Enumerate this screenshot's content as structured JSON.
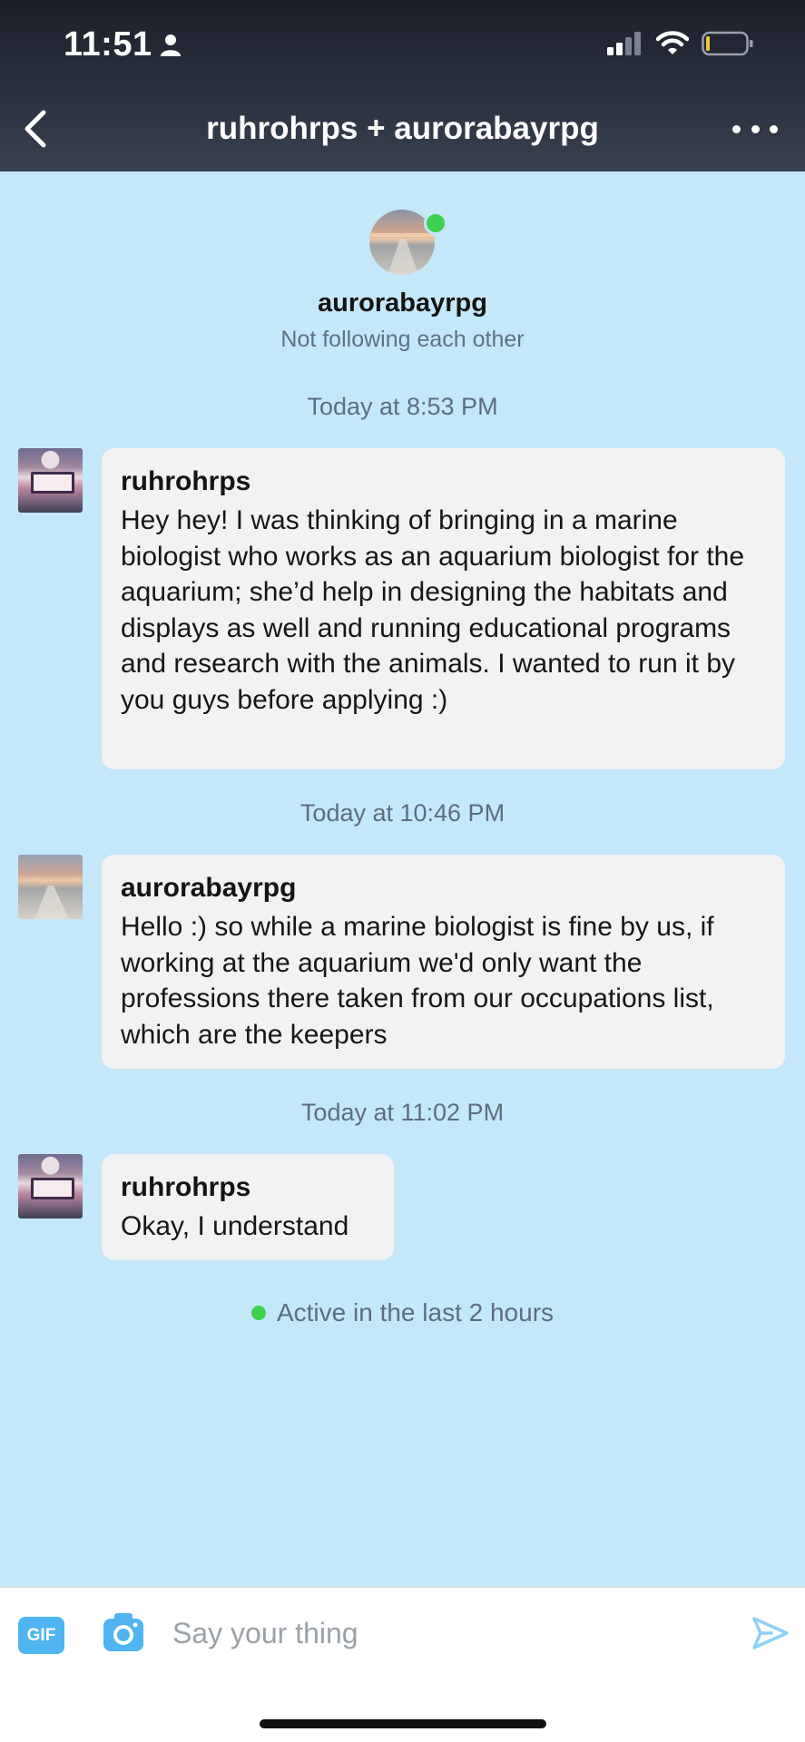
{
  "status_bar": {
    "time": "11:51",
    "battery_color": "#f4c43d"
  },
  "nav": {
    "title": "ruhrohrps + aurorabayrpg",
    "back_icon": "chevron-left-icon",
    "more_icon": "more-horizontal-icon"
  },
  "profile": {
    "name": "aurorabayrpg",
    "subtitle": "Not following each other",
    "online": true
  },
  "conversation": {
    "stamps": [
      "Today at 8:53 PM",
      "Today at 10:46 PM",
      "Today at 11:02 PM"
    ],
    "messages": [
      {
        "author": "ruhrohrps",
        "text": "Hey hey! I was thinking of bringing in a marine biologist who works as an aquarium biologist for the aquarium; she’d help in designing the habitats and displays as well and running educational programs and research with the animals. I wanted to run it by you guys before applying :)"
      },
      {
        "author": "aurorabayrpg",
        "text": "Hello :) so while a marine biologist is fine by us, if working at the aquarium we'd only want the professions there taken from our occupations list, which are the keepers"
      },
      {
        "author": "ruhrohrps",
        "text": "Okay, I understand"
      }
    ],
    "active_status": "Active in the last 2 hours"
  },
  "composer": {
    "gif_label": "GIF",
    "placeholder": "Say your thing",
    "value": "",
    "accent_color": "#4fb5f0"
  },
  "colors": {
    "background": "#c4e8fa",
    "bubble": "#f2f2f2",
    "online": "#3ed04f"
  }
}
